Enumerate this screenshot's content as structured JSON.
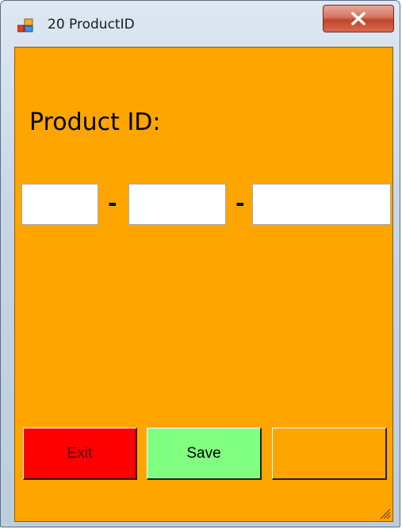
{
  "window": {
    "title": "20 ProductID",
    "client_color": "#ffa500"
  },
  "form": {
    "label": "Product ID:",
    "separators": [
      "-",
      "-"
    ],
    "fields": [
      {
        "value": "",
        "placeholder": ""
      },
      {
        "value": "",
        "placeholder": ""
      },
      {
        "value": "",
        "placeholder": ""
      }
    ]
  },
  "buttons": {
    "exit_label": "Exit",
    "save_label": "Save",
    "blank_label": "",
    "exit_color": "#ff0000",
    "save_color": "#80ff80",
    "blank_color": "#ffa500"
  },
  "icons": {
    "app": "app-icon",
    "close": "close-icon",
    "grip": "size-grip-icon"
  }
}
